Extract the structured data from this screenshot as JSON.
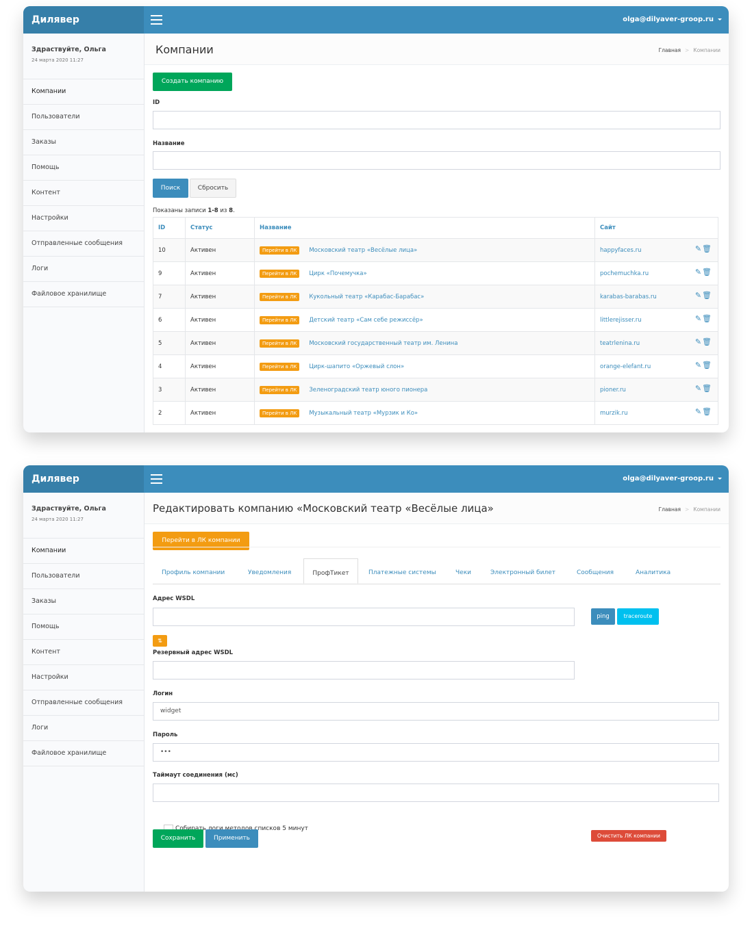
{
  "brand": "Дилявер",
  "user_email": "olga@dilyaver-groop.ru",
  "greeting": "Здраствуйте, Ольга",
  "greeting_date": "24 марта 2020 11:27",
  "menu": [
    "Компании",
    "Пользователи",
    "Заказы",
    "Помощь",
    "Контент",
    "Настройки",
    "Отправленные сообщения",
    "Логи",
    "Файловое хранилище"
  ],
  "breadcrumb": {
    "home": "Главная",
    "sep": ">",
    "current": "Компании"
  },
  "list_page": {
    "title": "Компании",
    "create_button": "Создать компанию",
    "filter_id_label": "ID",
    "filter_name_label": "Название",
    "search_button": "Поиск",
    "reset_button": "Сбросить",
    "summary_prefix": "Показаны записи ",
    "summary_range": "1-8",
    "summary_mid": " из ",
    "summary_total": "8",
    "summary_end": ".",
    "columns": [
      "ID",
      "Статус",
      "Название",
      "Сайт"
    ],
    "lk_label": "Перейти в ЛК",
    "rows": [
      {
        "id": "10",
        "status": "Активен",
        "name": "Московский театр «Весёлые лица»",
        "site": "happyfaces.ru"
      },
      {
        "id": "9",
        "status": "Активен",
        "name": "Цирк «Почемучка»",
        "site": "pochemuchka.ru"
      },
      {
        "id": "7",
        "status": "Активен",
        "name": "Кукольный театр «Карабас-Барабас»",
        "site": "karabas-barabas.ru"
      },
      {
        "id": "6",
        "status": "Активен",
        "name": "Детский театр «Сам себе режиссёр»",
        "site": "littlerejisser.ru"
      },
      {
        "id": "5",
        "status": "Активен",
        "name": "Московский государственный театр им. Ленина",
        "site": "teatrlenina.ru"
      },
      {
        "id": "4",
        "status": "Активен",
        "name": "Цирк-шапито «Оржевый слон»",
        "site": "orange-elefant.ru"
      },
      {
        "id": "3",
        "status": "Активен",
        "name": "Зеленоградский театр юного пионера",
        "site": "pioner.ru"
      },
      {
        "id": "2",
        "status": "Активен",
        "name": "Музыкальный театр  «Мурзик и Ко»",
        "site": "murzik.ru"
      }
    ]
  },
  "edit_page": {
    "title": "Редактировать компанию «Московский театр «Весёлые лица»",
    "goto_lk_button": "Перейти в ЛК компании",
    "tabs": [
      "Профиль компании",
      "Уведомления",
      "ПрофТикет",
      "Платежные системы",
      "Чеки",
      "Электронный билет",
      "Сообщения",
      "Аналитика"
    ],
    "active_tab": "ПрофТикет",
    "wsdl_label": "Адрес WSDL",
    "ping_button": "ping",
    "traceroute_button": "traceroute",
    "swap_button": "⇅",
    "reserve_wsdl_label": "Резервный адрес WSDL",
    "login_label": "Логин",
    "login_value": "widget",
    "password_label": "Пароль",
    "password_value": "•••",
    "timeout_label": "Таймаут соединения (мс)",
    "collect_logs_label": "Собирать логи методов списков 5 минут",
    "save_button": "Сохранить",
    "apply_button": "Применить",
    "clear_lk_button": "Очистить ЛК компании"
  },
  "colors": {
    "header": "#3c8dbc",
    "brand": "#367fa9",
    "green": "#00a65a",
    "orange": "#f39c12",
    "blue": "#3c8dbc",
    "cyan": "#00c0ef",
    "red": "#dd4b39"
  }
}
